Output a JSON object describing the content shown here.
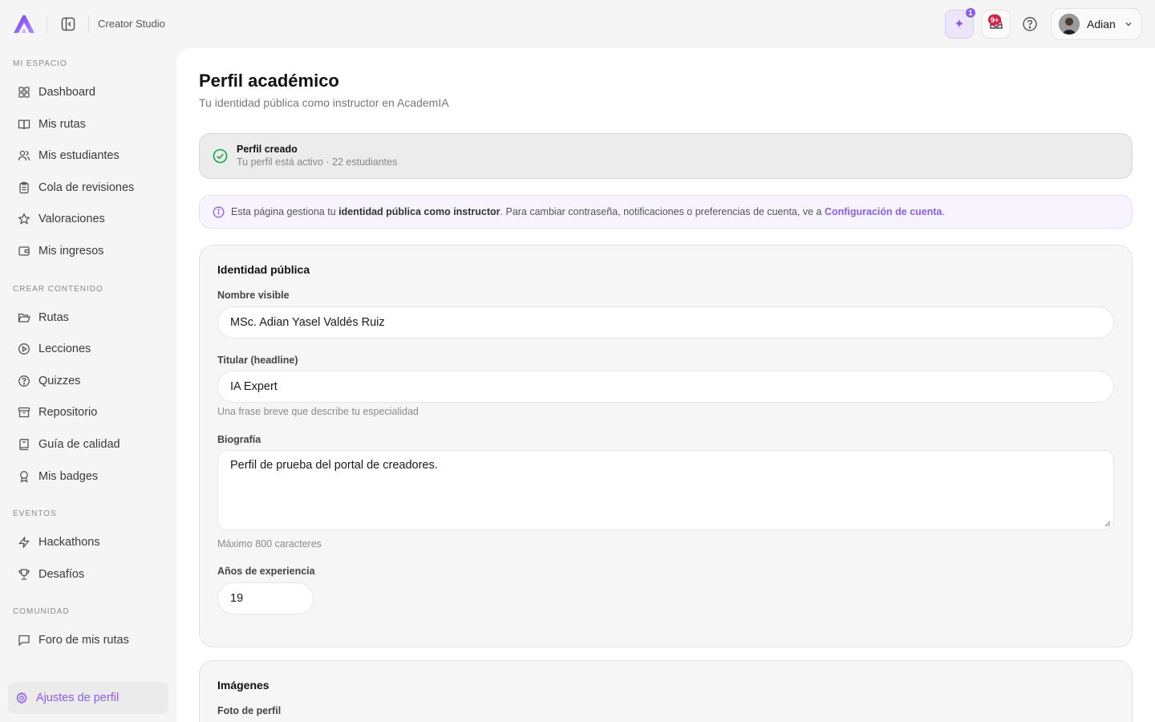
{
  "header": {
    "studio_label": "Creator Studio",
    "ai_badge_count": "1",
    "notifications_badge": "9+",
    "user_name": "Adian",
    "colors": {
      "accent": "#8b5cf6",
      "badge_red": "#e11d48"
    }
  },
  "sidebar": {
    "sections": {
      "mi_espacio": "MI ESPACIO",
      "crear_contenido": "CREAR CONTENIDO",
      "eventos": "EVENTOS",
      "comunidad": "COMUNIDAD"
    },
    "items": {
      "dashboard": "Dashboard",
      "mis_rutas": "Mis rutas",
      "mis_estudiantes": "Mis estudiantes",
      "cola_revisiones": "Cola de revisiones",
      "valoraciones": "Valoraciones",
      "mis_ingresos": "Mis ingresos",
      "rutas": "Rutas",
      "lecciones": "Lecciones",
      "quizzes": "Quizzes",
      "repositorio": "Repositorio",
      "guia_calidad": "Guía de calidad",
      "mis_badges": "Mis badges",
      "hackathons": "Hackathons",
      "desafios": "Desafíos",
      "foro": "Foro de mis rutas",
      "ajustes_perfil": "Ajustes de perfil"
    },
    "active_item": "ajustes_perfil"
  },
  "main": {
    "title": "Perfil académico",
    "subtitle": "Tu identidad pública como instructor en AcademIA",
    "status": {
      "title": "Perfil creado",
      "subtitle": "Tu perfil está activo · 22 estudiantes"
    },
    "info": {
      "prefix": "Esta página gestiona tu ",
      "bold": "identidad pública como instructor",
      "middle": ". Para cambiar contraseña, notificaciones o preferencias de cuenta, ve a ",
      "link": "Configuración de cuenta",
      "suffix": "."
    },
    "identity": {
      "title": "Identidad pública",
      "display_name_label": "Nombre visible",
      "display_name_value": "MSc. Adian Yasel Valdés Ruiz",
      "headline_label": "Titular (headline)",
      "headline_value": "IA Expert",
      "headline_help": "Una frase breve que describe tu especialidad",
      "bio_label": "Biografía",
      "bio_value": "Perfil de prueba del portal de creadores.",
      "bio_help": "Máximo 800 caracteres",
      "years_label": "Años de experiencia",
      "years_value": "19"
    },
    "images": {
      "title": "Imágenes",
      "photo_label": "Foto de perfil"
    }
  }
}
